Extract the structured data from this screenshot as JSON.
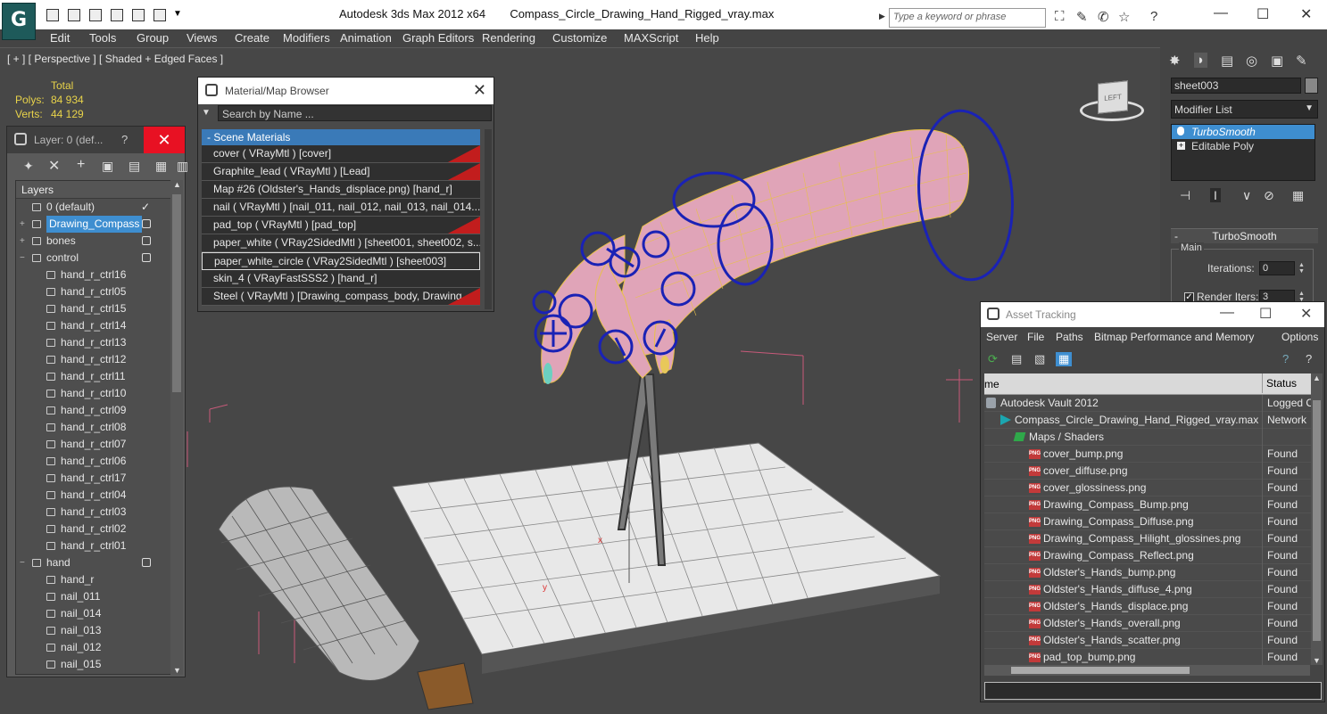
{
  "titlebar": {
    "app_name": "Autodesk 3ds Max  2012 x64",
    "file_name": "Compass_Circle_Drawing_Hand_Rigged_vray.max",
    "search_placeholder": "Type a keyword or phrase"
  },
  "menu": [
    "Edit",
    "Tools",
    "Group",
    "Views",
    "Create",
    "Modifiers",
    "Animation",
    "Graph Editors",
    "Rendering",
    "Customize",
    "MAXScript",
    "Help"
  ],
  "viewport": {
    "label": "[ + ] [ Perspective ] [ Shaded + Edged Faces ]",
    "stats_header": "Total",
    "polys_label": "Polys:",
    "polys_value": "84 934",
    "verts_label": "Verts:",
    "verts_value": "44 129",
    "viewcube_face": "LEFT"
  },
  "layer_explorer": {
    "title": "Layer: 0 (def...",
    "help": "?",
    "column_header": "Layers",
    "rows": [
      {
        "name": "0 (default)",
        "indent": 0,
        "expander": "",
        "checked": true
      },
      {
        "name": "Drawing_Compass",
        "indent": 0,
        "expander": "+",
        "selected": true
      },
      {
        "name": "bones",
        "indent": 0,
        "expander": "+"
      },
      {
        "name": "control",
        "indent": 0,
        "expander": "−"
      },
      {
        "name": "hand_r_ctrl16",
        "indent": 1
      },
      {
        "name": "hand_r_ctrl05",
        "indent": 1
      },
      {
        "name": "hand_r_ctrl15",
        "indent": 1
      },
      {
        "name": "hand_r_ctrl14",
        "indent": 1
      },
      {
        "name": "hand_r_ctrl13",
        "indent": 1
      },
      {
        "name": "hand_r_ctrl12",
        "indent": 1
      },
      {
        "name": "hand_r_ctrl11",
        "indent": 1
      },
      {
        "name": "hand_r_ctrl10",
        "indent": 1
      },
      {
        "name": "hand_r_ctrl09",
        "indent": 1
      },
      {
        "name": "hand_r_ctrl08",
        "indent": 1
      },
      {
        "name": "hand_r_ctrl07",
        "indent": 1
      },
      {
        "name": "hand_r_ctrl06",
        "indent": 1
      },
      {
        "name": "hand_r_ctrl17",
        "indent": 1
      },
      {
        "name": "hand_r_ctrl04",
        "indent": 1
      },
      {
        "name": "hand_r_ctrl03",
        "indent": 1
      },
      {
        "name": "hand_r_ctrl02",
        "indent": 1
      },
      {
        "name": "hand_r_ctrl01",
        "indent": 1
      },
      {
        "name": "hand",
        "indent": 0,
        "expander": "−"
      },
      {
        "name": "hand_r",
        "indent": 1
      },
      {
        "name": "nail_011",
        "indent": 1
      },
      {
        "name": "nail_014",
        "indent": 1
      },
      {
        "name": "nail_013",
        "indent": 1
      },
      {
        "name": "nail_012",
        "indent": 1
      },
      {
        "name": "nail_015",
        "indent": 1
      }
    ]
  },
  "material_browser": {
    "title": "Material/Map Browser",
    "search_placeholder": "Search by Name ...",
    "group_label": "- Scene Materials",
    "materials": [
      {
        "label": "cover  ( VRayMtl )  [cover]",
        "swatch": true
      },
      {
        "label": "Graphite_lead  ( VRayMtl )  [Lead]",
        "swatch": true
      },
      {
        "label": "Map #26 (Oldster's_Hands_displace.png) [hand_r]",
        "swatch": false
      },
      {
        "label": "nail  ( VRayMtl )  [nail_011, nail_012, nail_013, nail_014...",
        "swatch": false
      },
      {
        "label": "pad_top  ( VRayMtl )  [pad_top]",
        "swatch": true
      },
      {
        "label": "paper_white  ( VRay2SidedMtl )  [sheet001, sheet002, s...",
        "swatch": false
      },
      {
        "label": "paper_white_circle  ( VRay2SidedMtl )  [sheet003]",
        "swatch": false,
        "selected": true
      },
      {
        "label": "skin_4  ( VRayFastSSS2 )  [hand_r]",
        "swatch": false
      },
      {
        "label": "Steel  ( VRayMtl )  [Drawing_compass_body, Drawing_c...",
        "swatch": true
      }
    ]
  },
  "command_panel": {
    "object_name": "sheet003",
    "modifier_list_label": "Modifier List",
    "stack": [
      {
        "label": "TurboSmooth",
        "active": true
      },
      {
        "label": "Editable Poly",
        "active": false
      }
    ],
    "rollout_title": "TurboSmooth",
    "group_label": "Main",
    "iterations_label": "Iterations:",
    "iterations_value": "0",
    "render_iters_label": "Render Iters:",
    "render_iters_value": "3",
    "render_iters_checked": true
  },
  "asset_tracking": {
    "title": "Asset Tracking",
    "menu": [
      "Server",
      "File",
      "Paths",
      "Bitmap Performance and Memory",
      "Options"
    ],
    "col_name": "me",
    "col_status": "Status",
    "rows": [
      {
        "name": "Autodesk Vault 2012",
        "status": "Logged Ou",
        "indent": 0,
        "icon": "vault"
      },
      {
        "name": "Compass_Circle_Drawing_Hand_Rigged_vray.max",
        "status": "Network",
        "indent": 1,
        "icon": "max"
      },
      {
        "name": "Maps / Shaders",
        "status": "",
        "indent": 2,
        "icon": "folder"
      },
      {
        "name": "cover_bump.png",
        "status": "Found",
        "indent": 3,
        "icon": "png"
      },
      {
        "name": "cover_diffuse.png",
        "status": "Found",
        "indent": 3,
        "icon": "png"
      },
      {
        "name": "cover_glossiness.png",
        "status": "Found",
        "indent": 3,
        "icon": "png"
      },
      {
        "name": "Drawing_Compass_Bump.png",
        "status": "Found",
        "indent": 3,
        "icon": "png"
      },
      {
        "name": "Drawing_Compass_Diffuse.png",
        "status": "Found",
        "indent": 3,
        "icon": "png"
      },
      {
        "name": "Drawing_Compass_Hilight_glossines.png",
        "status": "Found",
        "indent": 3,
        "icon": "png"
      },
      {
        "name": "Drawing_Compass_Reflect.png",
        "status": "Found",
        "indent": 3,
        "icon": "png"
      },
      {
        "name": "Oldster's_Hands_bump.png",
        "status": "Found",
        "indent": 3,
        "icon": "png"
      },
      {
        "name": "Oldster's_Hands_diffuse_4.png",
        "status": "Found",
        "indent": 3,
        "icon": "png"
      },
      {
        "name": "Oldster's_Hands_displace.png",
        "status": "Found",
        "indent": 3,
        "icon": "png"
      },
      {
        "name": "Oldster's_Hands_overall.png",
        "status": "Found",
        "indent": 3,
        "icon": "png"
      },
      {
        "name": "Oldster's_Hands_scatter.png",
        "status": "Found",
        "indent": 3,
        "icon": "png"
      },
      {
        "name": "pad_top_bump.png",
        "status": "Found",
        "indent": 3,
        "icon": "png"
      }
    ],
    "png_icon_text": "PNG"
  },
  "colors": {
    "selection_blue": "#3e8ed0",
    "stats_yellow": "#e8d34a",
    "close_red": "#e81123",
    "material_swatch_red": "#c21d1d"
  }
}
